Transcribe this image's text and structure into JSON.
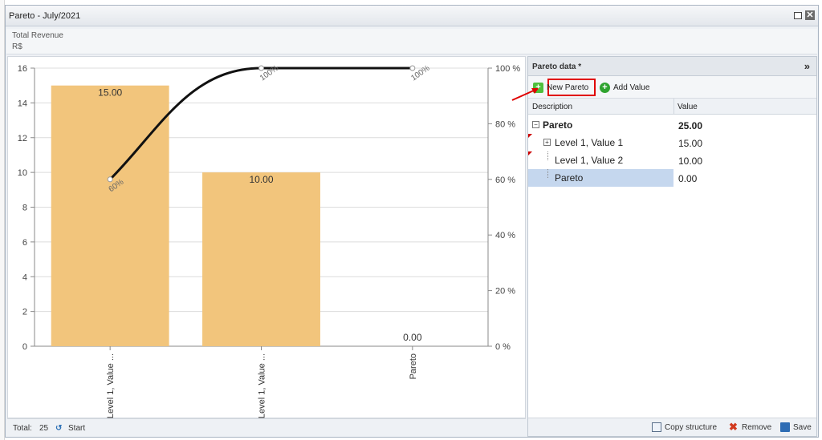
{
  "window": {
    "title": "Pareto - July/2021"
  },
  "subheader": {
    "line1": "Total Revenue",
    "line2": "R$"
  },
  "chart_data": {
    "type": "bar",
    "categories": [
      "Level 1, Value ...",
      "Level 1, Value ...",
      "Pareto"
    ],
    "values": [
      15.0,
      10.0,
      0.0
    ],
    "value_labels": [
      "15.00",
      "10.00",
      "0.00"
    ],
    "ylim": [
      0,
      16
    ],
    "y_ticks": [
      0,
      2,
      4,
      6,
      8,
      10,
      12,
      14,
      16
    ],
    "y2_ticks": [
      "0 %",
      "20 %",
      "40 %",
      "60 %",
      "80 %",
      "100 %"
    ],
    "y2lim": [
      0,
      100
    ],
    "cumulative_percent": [
      60,
      100,
      100
    ],
    "cumulative_labels": [
      "60%",
      "100%",
      "100%"
    ],
    "bar_color": "#f2c57c",
    "line_color": "#111111",
    "grid": true
  },
  "footer": {
    "total_label": "Total:",
    "total_value": "25",
    "start_label": "Start"
  },
  "panel": {
    "title": "Pareto data *",
    "collapse_glyph": "»",
    "toolbar": {
      "new_pareto": "New Pareto",
      "add_value": "Add Value"
    },
    "columns": {
      "description": "Description",
      "value": "Value"
    },
    "rows": [
      {
        "description": "Pareto",
        "value": "25.00"
      },
      {
        "description": "Level 1, Value 1",
        "value": "15.00"
      },
      {
        "description": "Level 1, Value 2",
        "value": "10.00"
      },
      {
        "description": "Pareto",
        "value": "0.00"
      }
    ],
    "footer": {
      "copy": "Copy structure",
      "remove": "Remove",
      "save": "Save"
    }
  },
  "colors": {
    "highlight": "#e00000",
    "selected_row": "#c5d7ee",
    "add_green": "#3aa53a"
  }
}
